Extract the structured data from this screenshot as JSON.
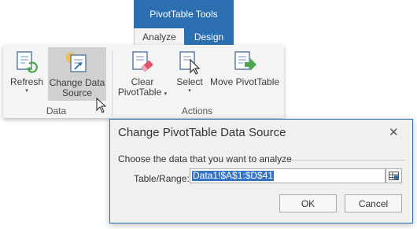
{
  "ribbon": {
    "context_header": "PivotTable Tools",
    "tabs": [
      {
        "label": "Analyze"
      },
      {
        "label": "Design"
      }
    ],
    "groups": {
      "data": {
        "label": "Data",
        "refresh": {
          "label": "Refresh",
          "dropdown": "▾",
          "icon": "refresh-icon"
        },
        "change_source": {
          "line1": "Change Data",
          "line2": "Source",
          "icon": "change-data-source-icon"
        }
      },
      "actions": {
        "label": "Actions",
        "clear": {
          "line1": "Clear",
          "line2": "PivotTable",
          "dropdown": "▾",
          "icon": "clear-pivottable-icon"
        },
        "select": {
          "label": "Select",
          "dropdown": "▾",
          "icon": "select-icon"
        },
        "move": {
          "label": "Move PivotTable",
          "icon": "move-pivottable-icon"
        }
      }
    }
  },
  "dialog": {
    "title": "Change PivotTable Data Source",
    "close": "✕",
    "section_label": "Choose the data that you want to analyze",
    "range_label": "Table/Range:",
    "range_value": "Data1!$A$1:$D$41",
    "ok": "OK",
    "cancel": "Cancel"
  },
  "colors": {
    "accent": "#2b6fb1",
    "selection": "#3373c4",
    "ribbon_bg": "#f4f4f4",
    "hover_bg": "#d0d0d0"
  }
}
